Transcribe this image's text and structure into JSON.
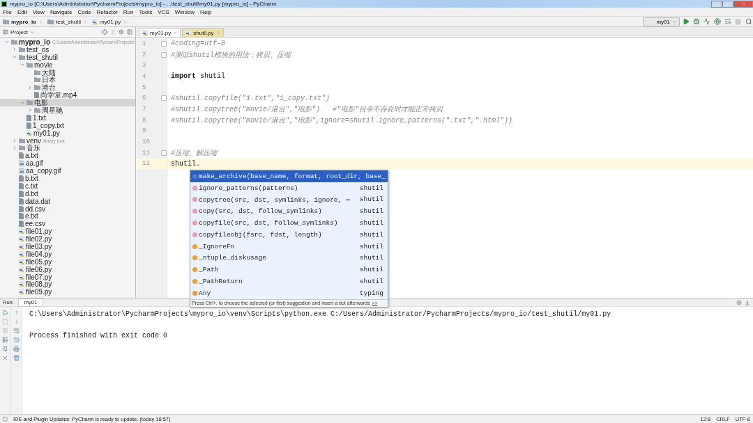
{
  "window": {
    "title": "mypro_io [C:\\Users\\Administrator\\PycharmProjects\\mypro_io] - ...\\test_shutil\\my01.py [mypro_io] - PyCharm"
  },
  "menu": [
    "File",
    "Edit",
    "View",
    "Navigate",
    "Code",
    "Refactor",
    "Run",
    "Tools",
    "VCS",
    "Window",
    "Help"
  ],
  "breadcrumbs": [
    {
      "label": "mypro_io",
      "kind": "folder"
    },
    {
      "label": "test_shutil",
      "kind": "folder"
    },
    {
      "label": "my01.py",
      "kind": "pyfile"
    }
  ],
  "run_config": "my01",
  "project_panel": {
    "title": "Project",
    "tree": [
      {
        "label": "mypro_io",
        "kind": "folder",
        "expanded": true,
        "selected": false,
        "hint": "C:\\Users\\Administrator\\PycharmProjects\\",
        "children": [
          {
            "label": "test_os",
            "kind": "folder",
            "expanded": false,
            "selected": false
          },
          {
            "label": "test_shutil",
            "kind": "folder",
            "expanded": true,
            "selected": false,
            "children": [
              {
                "label": "movie",
                "kind": "folder",
                "expanded": true,
                "selected": false,
                "children": [
                  {
                    "label": "大陆",
                    "kind": "empty_folder",
                    "expanded": false,
                    "selected": false
                  },
                  {
                    "label": "日本",
                    "kind": "empty_folder",
                    "expanded": false,
                    "selected": false
                  },
                  {
                    "label": "港台",
                    "kind": "folder",
                    "expanded": false,
                    "selected": false
                  },
                  {
                    "label": "尚学堂.mp4",
                    "kind": "file",
                    "expanded": false,
                    "selected": false
                  }
                ]
              },
              {
                "label": "电影",
                "kind": "folder",
                "expanded": true,
                "selected": true,
                "children": [
                  {
                    "label": "周星驰",
                    "kind": "folder",
                    "expanded": false,
                    "selected": false
                  }
                ]
              },
              {
                "label": "1.txt",
                "kind": "file",
                "expanded": false,
                "selected": false
              },
              {
                "label": "1_copy.txt",
                "kind": "file",
                "expanded": false,
                "selected": false
              },
              {
                "label": "my01.py",
                "kind": "pyfile",
                "expanded": false,
                "selected": false
              }
            ]
          },
          {
            "label": "venv",
            "kind": "folder",
            "expanded": false,
            "selected": false,
            "hint": "library root"
          },
          {
            "label": "音乐",
            "kind": "folder",
            "expanded": false,
            "selected": false
          },
          {
            "label": "a.txt",
            "kind": "file",
            "expanded": false,
            "selected": false
          },
          {
            "label": "aa.gif",
            "kind": "image",
            "expanded": false,
            "selected": false
          },
          {
            "label": "aa_copy.gif",
            "kind": "image",
            "expanded": false,
            "selected": false
          },
          {
            "label": "b.txt",
            "kind": "file",
            "expanded": false,
            "selected": false
          },
          {
            "label": "c.txt",
            "kind": "file",
            "expanded": false,
            "selected": false
          },
          {
            "label": "d.txt",
            "kind": "file",
            "expanded": false,
            "selected": false
          },
          {
            "label": "data.dat",
            "kind": "file",
            "expanded": false,
            "selected": false
          },
          {
            "label": "dd.csv",
            "kind": "file",
            "expanded": false,
            "selected": false
          },
          {
            "label": "e.txt",
            "kind": "file",
            "expanded": false,
            "selected": false
          },
          {
            "label": "ee.csv",
            "kind": "file",
            "expanded": false,
            "selected": false
          },
          {
            "label": "file01.py",
            "kind": "pyfile",
            "expanded": false,
            "selected": false
          },
          {
            "label": "file02.py",
            "kind": "pyfile",
            "expanded": false,
            "selected": false
          },
          {
            "label": "file03.py",
            "kind": "pyfile",
            "expanded": false,
            "selected": false
          },
          {
            "label": "file04.py",
            "kind": "pyfile",
            "expanded": false,
            "selected": false
          },
          {
            "label": "file05.py",
            "kind": "pyfile",
            "expanded": false,
            "selected": false
          },
          {
            "label": "file06.py",
            "kind": "pyfile",
            "expanded": false,
            "selected": false
          },
          {
            "label": "file07.py",
            "kind": "pyfile",
            "expanded": false,
            "selected": false
          },
          {
            "label": "file08.py",
            "kind": "pyfile",
            "expanded": false,
            "selected": false
          },
          {
            "label": "file09.py",
            "kind": "pyfile",
            "expanded": false,
            "selected": false
          }
        ]
      }
    ]
  },
  "editor_tabs": [
    {
      "label": "my01.py",
      "selected": true
    },
    {
      "label": "shutil.py",
      "selected": false
    }
  ],
  "code_lines": [
    {
      "number": "1",
      "text": "#coding=utf-8",
      "kind": "comment",
      "fold": true,
      "current": false
    },
    {
      "number": "2",
      "text": "#测试shutil模块的用法：拷贝、压缩",
      "kind": "comment",
      "fold": true,
      "current": false
    },
    {
      "number": "3",
      "kind": "blank",
      "fold": false,
      "current": false
    },
    {
      "number": "4",
      "text": "**import** shutil",
      "kind": "code",
      "fold": false,
      "current": false
    },
    {
      "number": "5",
      "kind": "blank",
      "fold": false,
      "current": false
    },
    {
      "number": "6",
      "text": "#shutil.copyfile(\"1.txt\",\"1_copy.txt\")",
      "kind": "comment",
      "fold": true,
      "current": false
    },
    {
      "number": "7",
      "text": "#shutil.copytree(\"movie/港台\",\"电影\")   #\"电影\"目录不存在时才能正常拷贝",
      "kind": "comment",
      "fold": false,
      "current": false
    },
    {
      "number": "8",
      "text": "#shutil.copytree(\"movie/港台\",\"电影\",ignore=shutil.ignore_patterns(\"*.txt\",\"*.html\"))",
      "kind": "comment",
      "fold": false,
      "current": false
    },
    {
      "number": "9",
      "kind": "blank",
      "fold": false,
      "current": false
    },
    {
      "number": "10",
      "kind": "blank",
      "fold": false,
      "current": false
    },
    {
      "number": "11",
      "text": "#压缩、解压缩",
      "kind": "comment",
      "fold": true,
      "current": false
    },
    {
      "number": "12",
      "text": "shutil.",
      "kind": "code",
      "fold": false,
      "current": true
    }
  ],
  "completion": {
    "items": [
      {
        "kind": "method",
        "name": "make_archive(base_name, format, root_dir, base_",
        "selected": true
      },
      {
        "kind": "function",
        "name": "ignore_patterns(patterns)",
        "source": "shutil",
        "selected": false
      },
      {
        "kind": "function",
        "name": "copytree(src, dst, symlinks, ignore, ⋯",
        "source": "shutil",
        "selected": false
      },
      {
        "kind": "function",
        "name": "copy(src, dst, follow_symlinks)",
        "source": "shutil",
        "selected": false
      },
      {
        "kind": "function",
        "name": "copyfile(src, dst, follow_symlinks)",
        "source": "shutil",
        "selected": false
      },
      {
        "kind": "function",
        "name": "copyfileobj(fsrc, fdst, length)",
        "source": "shutil",
        "selected": false
      },
      {
        "kind": "variable",
        "name": "_IgnoreFn",
        "source": "shutil",
        "selected": false
      },
      {
        "kind": "variable",
        "name": "_ntuple_diskusage",
        "source": "shutil",
        "selected": false
      },
      {
        "kind": "variable",
        "name": "_Path",
        "source": "shutil",
        "selected": false
      },
      {
        "kind": "variable",
        "name": "_PathReturn",
        "source": "shutil",
        "selected": false
      },
      {
        "kind": "variable",
        "name": "Any",
        "source": "typing",
        "selected": false
      }
    ],
    "hint": "Press Ctrl+. to choose the selected (or first) suggestion and insert a dot afterwards",
    "hint_link": ">>"
  },
  "run_panel": {
    "label": "Run:",
    "tab": "my01",
    "output": [
      "C:\\Users\\Administrator\\PycharmProjects\\mypro_io\\venv\\Scripts\\python.exe C:/Users/Administrator/PycharmProjects/mypro_io/test_shutil/my01.py",
      "Process finished with exit code 0"
    ]
  },
  "status_bar": {
    "message": "IDE and Plugin Updates: PyCharm is ready to update. (today 18:57)",
    "position": "12:8",
    "line_ending": "CRLF",
    "encoding": "UTF-8"
  }
}
